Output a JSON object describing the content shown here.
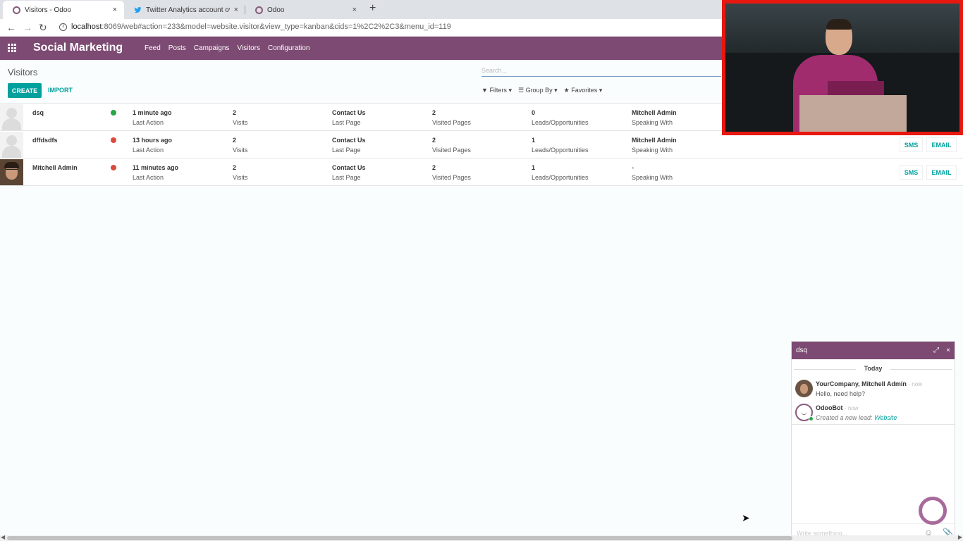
{
  "browser": {
    "tabs": [
      {
        "title": "Visitors - Odoo",
        "icon": "odoo-icon",
        "active": true
      },
      {
        "title": "Twitter Analytics account ove",
        "icon": "twitter-icon",
        "active": false
      },
      {
        "title": "Odoo",
        "icon": "odoo-icon",
        "active": false
      }
    ],
    "new_tab": "+",
    "close_glyph": "×",
    "url_host": "localhost",
    "url_rest": ":8069/web#action=233&model=website.visitor&view_type=kanban&cids=1%2C2%2C3&menu_id=119"
  },
  "navbar": {
    "app_title": "Social Marketing",
    "menu": [
      "Feed",
      "Posts",
      "Campaigns",
      "Visitors",
      "Configuration"
    ]
  },
  "control_panel": {
    "breadcrumb": "Visitors",
    "search_placeholder": "Search...",
    "create_label": "CREATE",
    "import_label": "IMPORT",
    "filters_label": "Filters",
    "group_by_label": "Group By",
    "favorites_label": "Favorites"
  },
  "visitors": [
    {
      "name": "dsq",
      "status_color": "#28a745",
      "avatar": "placeholder",
      "last_action": "1 minute ago",
      "last_action_label": "Last Action",
      "visits": "2",
      "visits_label": "Visits",
      "last_page": "Contact Us",
      "last_page_label": "Last Page",
      "visited_pages": "2",
      "visited_pages_label": "Visited Pages",
      "leads": "0",
      "leads_label": "Leads/Opportunities",
      "speaking_with": "Mitchell Admin",
      "speaking_with_label": "Speaking With",
      "sms_label": "",
      "email_label": ""
    },
    {
      "name": "dffdsdfs",
      "status_color": "#dc4b3a",
      "avatar": "placeholder",
      "last_action": "13 hours ago",
      "last_action_label": "Last Action",
      "visits": "2",
      "visits_label": "Visits",
      "last_page": "Contact Us",
      "last_page_label": "Last Page",
      "visited_pages": "2",
      "visited_pages_label": "Visited Pages",
      "leads": "1",
      "leads_label": "Leads/Opportunities",
      "speaking_with": "Mitchell Admin",
      "speaking_with_label": "Speaking With",
      "sms_label": "SMS",
      "email_label": "EMAIL"
    },
    {
      "name": "Mitchell Admin",
      "status_color": "#dc4b3a",
      "avatar": "photo",
      "last_action": "11 minutes ago",
      "last_action_label": "Last Action",
      "visits": "2",
      "visits_label": "Visits",
      "last_page": "Contact Us",
      "last_page_label": "Last Page",
      "visited_pages": "2",
      "visited_pages_label": "Visited Pages",
      "leads": "1",
      "leads_label": "Leads/Opportunities",
      "speaking_with": "-",
      "speaking_with_label": "Speaking With",
      "sms_label": "SMS",
      "email_label": "EMAIL"
    }
  ],
  "chat": {
    "title": "dsq",
    "expand_glyph": "⤢",
    "close_glyph": "×",
    "day": "Today",
    "messages": [
      {
        "author": "YourCompany, Mitchell Admin",
        "when": "- now",
        "text": "Hello, need help?",
        "avatar": "person"
      },
      {
        "author": "OdooBot",
        "when": "- now",
        "text": "Created a new lead: ",
        "link": "Website",
        "avatar": "bot"
      }
    ],
    "input_placeholder": "Write something...",
    "emoji_glyph": "☺",
    "attach_glyph": "📎"
  },
  "colors": {
    "brand": "#7c4a72",
    "accent": "#00a09d",
    "video_border": "#e8170f",
    "online": "#28a745",
    "offline": "#dc4b3a"
  }
}
